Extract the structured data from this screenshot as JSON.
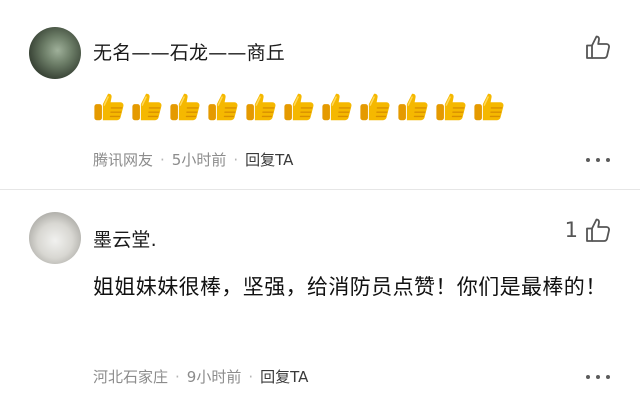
{
  "comments": [
    {
      "username": "无名——石龙——商丘",
      "avatar_icon": "avatar-photo",
      "content_type": "emoji",
      "emoji": {
        "name": "thumbs-up-emoji",
        "count": 11,
        "color": "#f5b800"
      },
      "meta": {
        "location": "腾讯网友",
        "time": "5小时前",
        "reply_label": "回复TA"
      },
      "like_count": "",
      "like_icon": "thumbs-up-outline-icon",
      "more_icon": "ellipsis-icon"
    },
    {
      "username": "墨云堂.",
      "avatar_icon": "avatar-photo",
      "content_type": "text",
      "text": "姐姐妹妹很棒，坚强，给消防员点赞！你们是最棒的！",
      "meta": {
        "location": "河北石家庄",
        "time": "9小时前",
        "reply_label": "回复TA"
      },
      "like_count": "1",
      "like_icon": "thumbs-up-outline-icon",
      "more_icon": "ellipsis-icon"
    }
  ],
  "separator": "·",
  "colors": {
    "meta_text": "#8c8c8c",
    "reply_text": "#3a3a3a",
    "divider": "#e6e6e6",
    "like_icon": "#555555"
  }
}
